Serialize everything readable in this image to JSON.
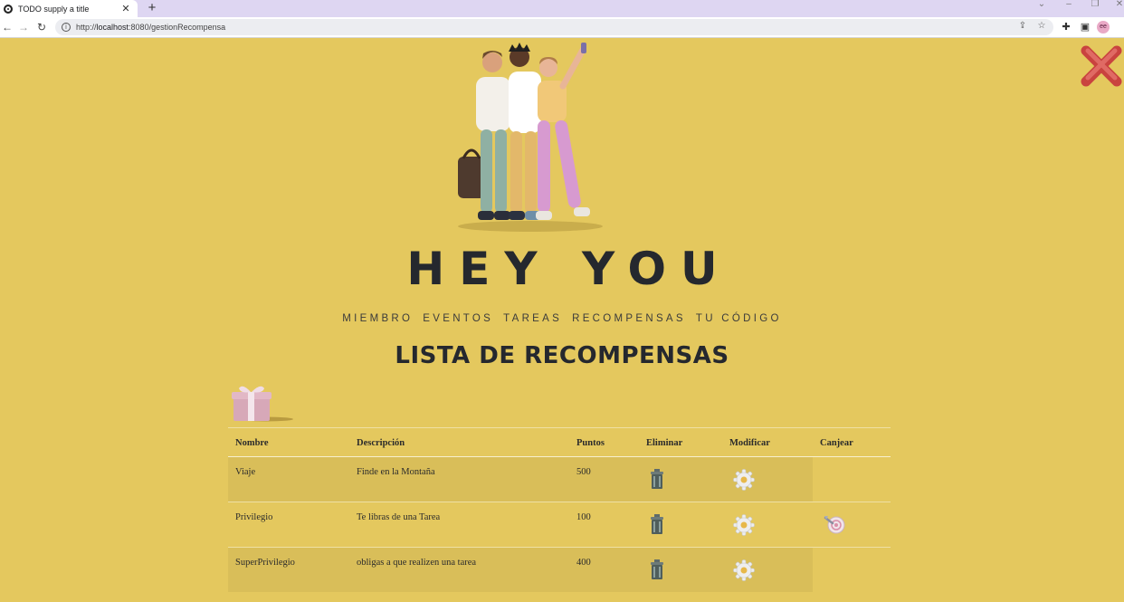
{
  "browser": {
    "tab_title": "TODO supply a title",
    "url_prefix": "http://",
    "url_host": "localhost",
    "url_path": ":8080/gestionRecompensa",
    "avatar_initials": "ee"
  },
  "brand": {
    "logo_text": "HEY YOU"
  },
  "nav": {
    "items": [
      "MIEMBRO",
      "EVENTOS",
      "TAREAS",
      "RECOMPENSAS",
      "TU CÓDIGO"
    ]
  },
  "page": {
    "title": "LISTA DE RECOMPENSAS"
  },
  "table": {
    "headers": {
      "nombre": "Nombre",
      "descripcion": "Descripción",
      "puntos": "Puntos",
      "eliminar": "Eliminar",
      "modificar": "Modificar",
      "canjear": "Canjear"
    },
    "rows": [
      {
        "nombre": "Viaje",
        "descripcion": "Finde en la Montaña",
        "puntos": "500",
        "canjear": false
      },
      {
        "nombre": "Privilegio",
        "descripcion": "Te libras de una Tarea",
        "puntos": "100",
        "canjear": true
      },
      {
        "nombre": "SuperPrivilegio",
        "descripcion": "obligas a que realizen una tarea",
        "puntos": "400",
        "canjear": false
      }
    ]
  },
  "icons": {
    "delete": "trash-icon",
    "modify": "gear-icon",
    "redeem": "redeem-icon",
    "close": "close-icon",
    "gift": "gift-icon"
  },
  "colors": {
    "page_background": "#e4c85e",
    "row_shade": "#d9be59",
    "heading": "#25282e",
    "close_x": "#d9534f"
  }
}
